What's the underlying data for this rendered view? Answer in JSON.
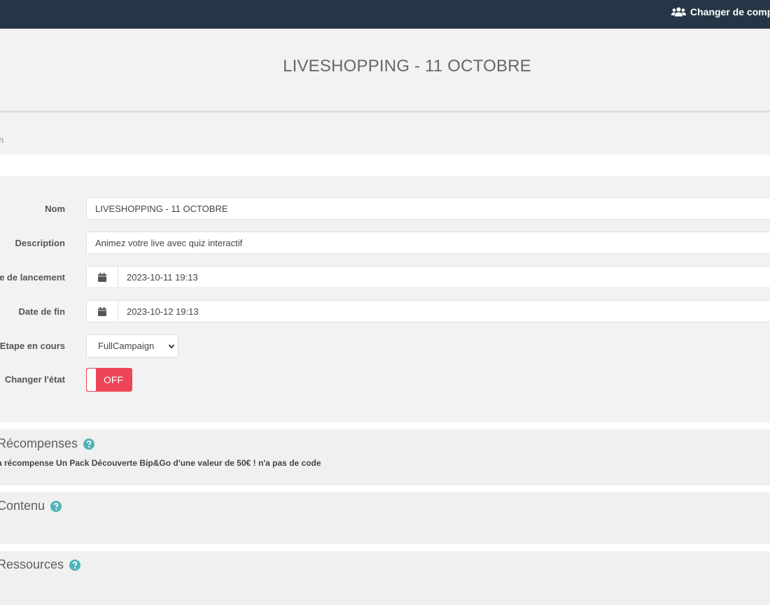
{
  "topbar": {
    "switch_account_label": "Changer de compte"
  },
  "page": {
    "title": "LIVESHOPPING - 11 OCTOBRE",
    "tab_label": "ration"
  },
  "form": {
    "name": {
      "label": "Nom",
      "value": "LIVESHOPPING - 11 OCTOBRE"
    },
    "description": {
      "label": "Description",
      "value": "Animez votre live avec quiz interactif"
    },
    "launch_date": {
      "label": "te de lancement",
      "value": "2023-10-11 19:13"
    },
    "end_date": {
      "label": "Date de fin",
      "value": "2023-10-12 19:13"
    },
    "current_step": {
      "label": "Etape en cours",
      "value": "FullCampaign"
    },
    "state": {
      "label": "Changer l'état",
      "value": "OFF"
    }
  },
  "sections": {
    "rewards": {
      "title": "Récompenses",
      "text": "a récompense Un Pack Découverte Bip&Go d'une valeur de 50€ ! n'a pas de code"
    },
    "content": {
      "title": "Contenu"
    },
    "resources": {
      "title": "Ressources"
    }
  },
  "colors": {
    "topbar": "#263646",
    "toggle_off": "#ee4556",
    "help_icon": "#4fb3b8"
  },
  "icons": [
    "users-icon",
    "calendar-icon",
    "chevron-down-icon",
    "help-icon"
  ]
}
